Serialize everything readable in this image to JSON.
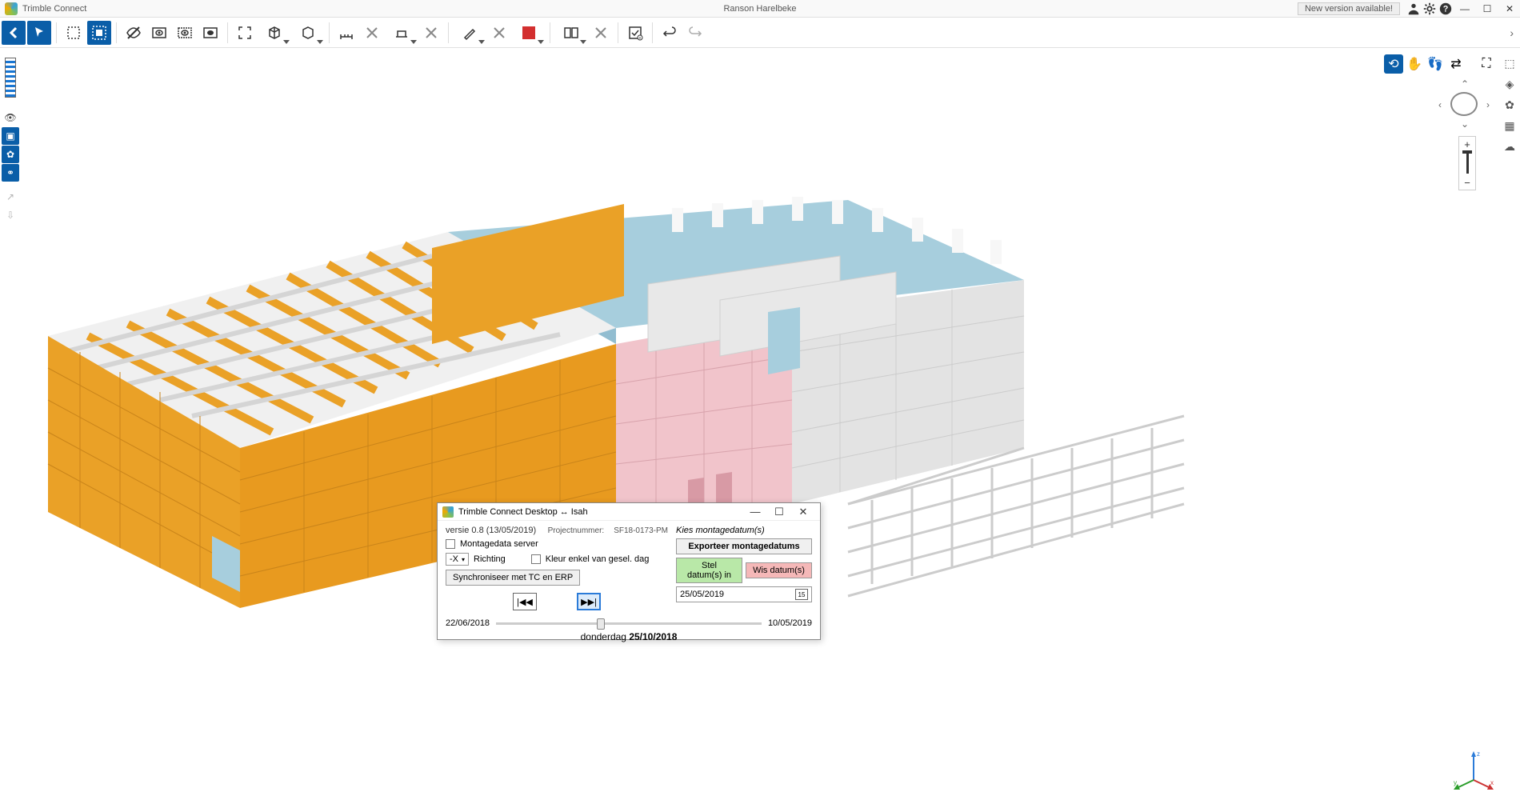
{
  "titlebar": {
    "app": "Trimble Connect",
    "project": "Ranson Harelbeke",
    "newversion": "New version available!"
  },
  "dialog": {
    "title": "Trimble Connect Desktop ↔ Isah",
    "version": "versie 0.8 (13/05/2019)",
    "project_label": "Projectnummer:",
    "project_value": "SF18-0173-PM",
    "chk_montagedata": "Montagedata server",
    "richting_value": "-X",
    "richting_label": "Richting",
    "chk_kleur": "Kleur enkel van gesel. dag",
    "btn_sync": "Synchroniseer met TC en ERP",
    "kies": "Kies montagedatum(s)",
    "btn_export": "Exporteer montagedatums",
    "btn_stel": "Stel datum(s) in",
    "btn_wis": "Wis datum(s)",
    "date_value": "25/05/2019",
    "cal": "15",
    "slider_start": "22/06/2018",
    "slider_end": "10/05/2019",
    "current_day": "donderdag",
    "current_date": "25/10/2018"
  }
}
